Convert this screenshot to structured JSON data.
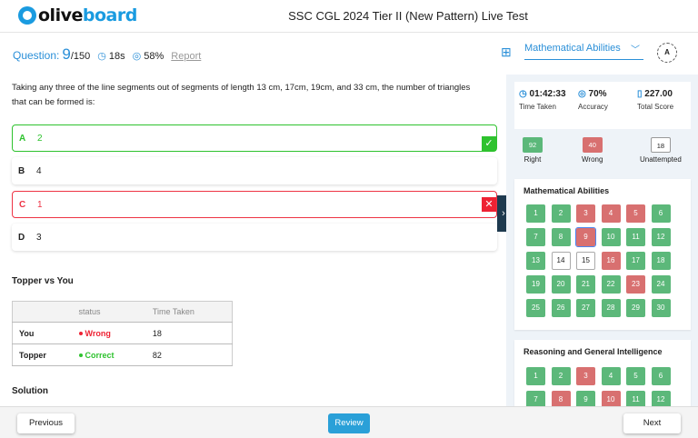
{
  "header": {
    "logo_dark": "olive",
    "logo_blue": "board",
    "title": "SSC CGL 2024 Tier II (New Pattern) Live Test"
  },
  "question": {
    "label": "Question:",
    "number": "9",
    "total": "/150",
    "time": "18s",
    "accuracy": "58%",
    "report": "Report",
    "text": "Taking any three of the line segments out of segments of length 13 cm, 17cm, 19cm, and 33 cm, the number of triangles that can be formed is:"
  },
  "options": [
    {
      "key": "A",
      "text": "2",
      "state": "correct"
    },
    {
      "key": "B",
      "text": "4",
      "state": "none"
    },
    {
      "key": "C",
      "text": "1",
      "state": "wrong"
    },
    {
      "key": "D",
      "text": "3",
      "state": "none"
    }
  ],
  "topper": {
    "title": "Topper vs You",
    "headers": [
      "",
      "status",
      "Time Taken"
    ],
    "rows": [
      {
        "name": "You",
        "status": "Wrong",
        "time": "18",
        "color": "#ee2233"
      },
      {
        "name": "Topper",
        "status": "Correct",
        "time": "82",
        "color": "#2ec22e"
      }
    ]
  },
  "solution_title": "Solution",
  "sidebar": {
    "section_select": "Mathematical Abilities",
    "lang_icon": "A",
    "stats": {
      "time": "01:42:33",
      "time_label": "Time Taken",
      "accuracy": "70%",
      "accuracy_label": "Accuracy",
      "score": "227.00",
      "score_label": "Total Score"
    },
    "counts": {
      "right": "92",
      "right_label": "Right",
      "wrong": "40",
      "wrong_label": "Wrong",
      "unattempted": "18",
      "unattempted_label": "Unattempted"
    },
    "sections": [
      {
        "title": "Mathematical Abilities",
        "questions": [
          "r",
          "r",
          "w",
          "w",
          "w",
          "r",
          "r",
          "r",
          "w",
          "r",
          "r",
          "r",
          "r",
          "u",
          "u",
          "w",
          "r",
          "r",
          "r",
          "r",
          "r",
          "r",
          "w",
          "r",
          "r",
          "r",
          "r",
          "r",
          "r",
          "r"
        ],
        "current": 9
      },
      {
        "title": "Reasoning and General Intelligence",
        "questions": [
          "r",
          "r",
          "w",
          "r",
          "r",
          "r",
          "r",
          "w",
          "r",
          "w",
          "r",
          "r"
        ],
        "current": 0
      }
    ]
  },
  "footer": {
    "previous": "Previous",
    "review": "Review",
    "next": "Next"
  },
  "colors": {
    "right": "#5cb87a",
    "wrong": "#d87070",
    "accent": "#2a8fd8"
  }
}
